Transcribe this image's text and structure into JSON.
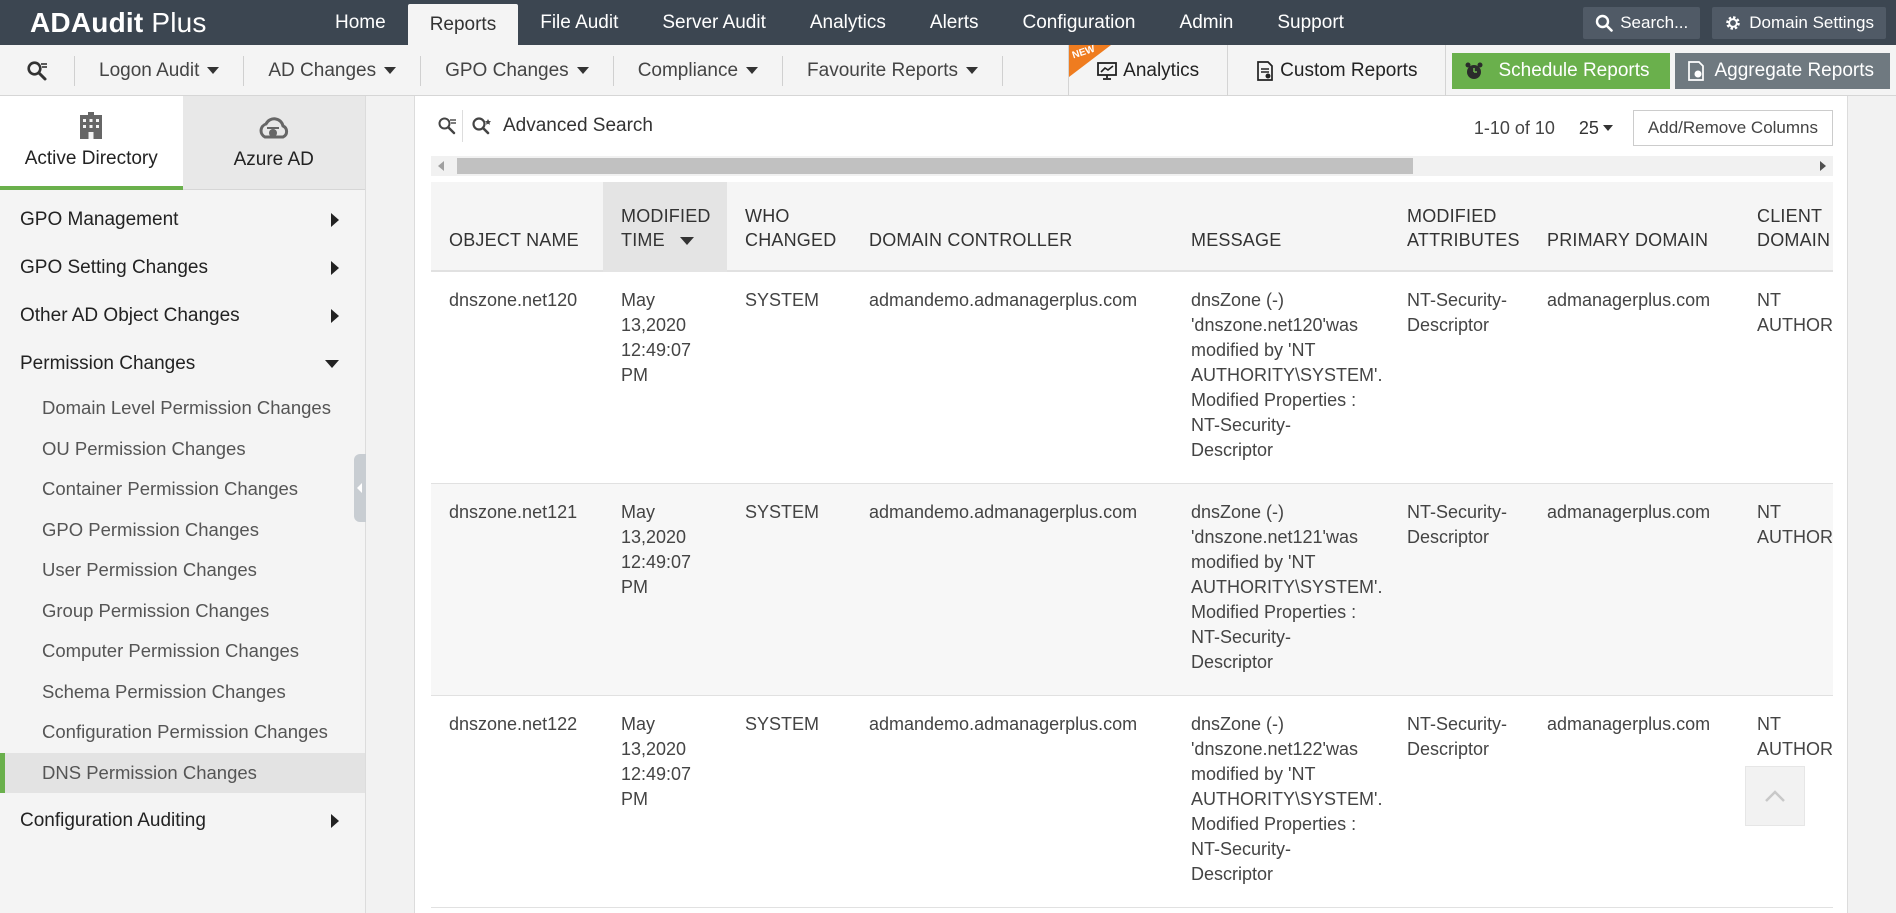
{
  "app": {
    "brand_bold": "ADAudit",
    "brand_rest": " Plus"
  },
  "topnav": {
    "items": [
      "Home",
      "Reports",
      "File Audit",
      "Server Audit",
      "Analytics",
      "Alerts",
      "Configuration",
      "Admin",
      "Support"
    ],
    "active": "Reports",
    "search_label": "Search...",
    "domain_settings_label": "Domain Settings"
  },
  "subnav": {
    "dropdowns": [
      "Logon Audit",
      "AD Changes",
      "GPO Changes",
      "Compliance",
      "Favourite Reports"
    ],
    "new_badge": "NEW",
    "analytics_label": "Analytics",
    "custom_reports_label": "Custom Reports",
    "schedule_reports_label": "Schedule Reports",
    "aggregate_reports_label": "Aggregate Reports"
  },
  "sidebar": {
    "tabs": [
      {
        "label": "Active Directory",
        "icon": "building-icon"
      },
      {
        "label": "Azure AD",
        "icon": "cloud-icon"
      }
    ],
    "active_tab": "Active Directory",
    "sections": [
      {
        "label": "GPO Management",
        "expanded": false
      },
      {
        "label": "GPO Setting Changes",
        "expanded": false
      },
      {
        "label": "Other AD Object Changes",
        "expanded": false
      },
      {
        "label": "Permission Changes",
        "expanded": true
      }
    ],
    "permission_items": [
      "Domain Level Permission Changes",
      "OU Permission Changes",
      "Container Permission Changes",
      "GPO Permission Changes",
      "User Permission Changes",
      "Group Permission Changes",
      "Computer Permission Changes",
      "Schema Permission Changes",
      "Configuration Permission Changes",
      "DNS Permission Changes"
    ],
    "active_item": "DNS Permission Changes",
    "last_section": "Configuration Auditing"
  },
  "report": {
    "advanced_search_label": "Advanced Search",
    "pagination": "1-10 of 10",
    "page_size": "25",
    "add_remove_columns_label": "Add/Remove Columns",
    "columns": [
      "OBJECT NAME",
      "MODIFIED\nTIME",
      "WHO\nCHANGED",
      "DOMAIN CONTROLLER",
      "MESSAGE",
      "MODIFIED\nATTRIBUTES",
      "PRIMARY DOMAIN",
      "CLIENT\nDOMAIN"
    ],
    "sorted_column": "MODIFIED TIME",
    "rows": [
      [
        "dnszone.net120",
        "May\n13,2020\n12:49:07\nPM",
        "SYSTEM",
        "admandemo.admanagerplus.com",
        "dnsZone (-)\n'dnszone.net120'was\nmodified by 'NT\nAUTHORITY\\SYSTEM'.\nModified Properties :\nNT-Security-\nDescriptor",
        "NT-Security-\nDescriptor",
        "admanagerplus.com",
        "NT\nAUTHORI"
      ],
      [
        "dnszone.net121",
        "May\n13,2020\n12:49:07\nPM",
        "SYSTEM",
        "admandemo.admanagerplus.com",
        "dnsZone (-)\n'dnszone.net121'was\nmodified by 'NT\nAUTHORITY\\SYSTEM'.\nModified Properties :\nNT-Security-\nDescriptor",
        "NT-Security-\nDescriptor",
        "admanagerplus.com",
        "NT\nAUTHORI"
      ],
      [
        "dnszone.net122",
        "May\n13,2020\n12:49:07\nPM",
        "SYSTEM",
        "admandemo.admanagerplus.com",
        "dnsZone (-)\n'dnszone.net122'was\nmodified by 'NT\nAUTHORITY\\SYSTEM'.\nModified Properties :\nNT-Security-\nDescriptor",
        "NT-Security-\nDescriptor",
        "admanagerplus.com",
        "NT\nAUTHORI"
      ]
    ]
  },
  "colors": {
    "topbar": "#3c4651",
    "accent_green": "#6ab04c",
    "new_badge": "#ef7c1f"
  }
}
